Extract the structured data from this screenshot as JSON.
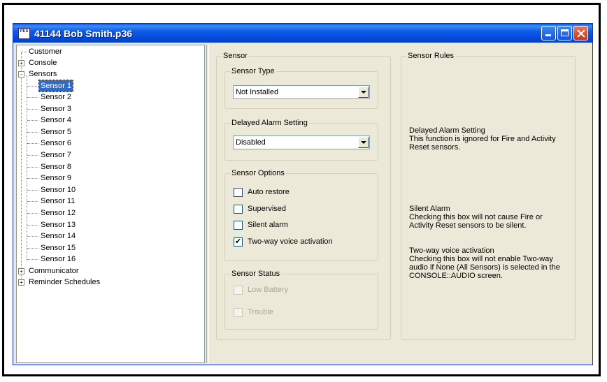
{
  "window": {
    "title": "41144 Bob Smith.p36",
    "icon_text": "PES"
  },
  "tree": {
    "items": [
      {
        "label": "Customer",
        "level": 0,
        "expander": ""
      },
      {
        "label": "Console",
        "level": 0,
        "expander": "+"
      },
      {
        "label": "Sensors",
        "level": 0,
        "expander": "-"
      },
      {
        "label": "Sensor 1",
        "level": 1,
        "selected": true
      },
      {
        "label": "Sensor 2",
        "level": 1
      },
      {
        "label": "Sensor 3",
        "level": 1
      },
      {
        "label": "Sensor 4",
        "level": 1
      },
      {
        "label": "Sensor 5",
        "level": 1
      },
      {
        "label": "Sensor 6",
        "level": 1
      },
      {
        "label": "Sensor 7",
        "level": 1
      },
      {
        "label": "Sensor 8",
        "level": 1
      },
      {
        "label": "Sensor 9",
        "level": 1
      },
      {
        "label": "Sensor 10",
        "level": 1
      },
      {
        "label": "Sensor 11",
        "level": 1
      },
      {
        "label": "Sensor 12",
        "level": 1
      },
      {
        "label": "Sensor 13",
        "level": 1
      },
      {
        "label": "Sensor 14",
        "level": 1
      },
      {
        "label": "Sensor 15",
        "level": 1
      },
      {
        "label": "Sensor 16",
        "level": 1
      },
      {
        "label": "Communicator",
        "level": 0,
        "expander": "+"
      },
      {
        "label": "Reminder Schedules",
        "level": 0,
        "expander": "+"
      }
    ]
  },
  "sensor": {
    "group_label": "Sensor",
    "type": {
      "label": "Sensor Type",
      "value": "Not Installed"
    },
    "delayed": {
      "label": "Delayed Alarm Setting",
      "value": "Disabled"
    },
    "options": {
      "label": "Sensor Options",
      "items": [
        {
          "label": "Auto restore",
          "checked": false
        },
        {
          "label": "Supervised",
          "checked": false
        },
        {
          "label": "Silent alarm",
          "checked": false
        },
        {
          "label": "Two-way voice activation",
          "checked": true
        }
      ]
    },
    "status": {
      "label": "Sensor Status",
      "items": [
        {
          "label": "Low Battery",
          "checked": false
        },
        {
          "label": "Trouble",
          "checked": false
        }
      ]
    }
  },
  "rules": {
    "label": "Sensor Rules",
    "blocks": [
      {
        "lines": [
          "Delayed Alarm Setting",
          "This function is ignored for Fire and Activity",
          "Reset sensors."
        ]
      },
      {
        "lines": [
          "Silent Alarm",
          "Checking this box will not cause Fire or",
          "Activity Reset sensors to be silent."
        ]
      },
      {
        "lines": [
          "Two-way voice activation",
          "Checking this box will not enable Two-way",
          "audio if None (All Sensors) is selected in the",
          "CONSOLE::AUDIO screen."
        ]
      }
    ]
  },
  "colors": {
    "title_bar": "#0a58e6",
    "selection": "#316ac5",
    "panel": "#ece9d8"
  }
}
